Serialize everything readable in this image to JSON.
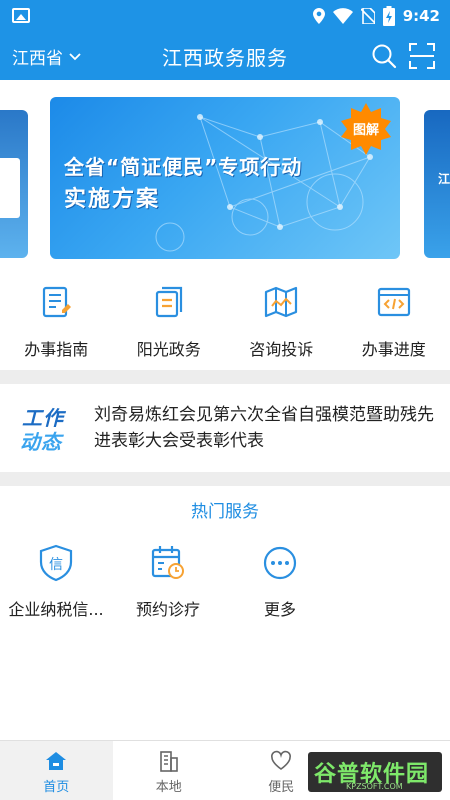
{
  "status_bar": {
    "time": "9:42"
  },
  "header": {
    "province": "江西省",
    "title": "江西政务服务"
  },
  "banner": {
    "line1": "全省“简证便民”专项行动",
    "line2": "实施方案",
    "badge": "图解",
    "right_peek": "江"
  },
  "quick_menu": [
    {
      "label": "办事指南",
      "icon": "guide-icon"
    },
    {
      "label": "阳光政务",
      "icon": "document-icon"
    },
    {
      "label": "咨询投诉",
      "icon": "map-icon"
    },
    {
      "label": "办事进度",
      "icon": "code-window-icon"
    }
  ],
  "news": {
    "tag_line1": "工作",
    "tag_line2": "动态",
    "headline": "刘奇易炼红会见第六次全省自强模范暨助残先进表彰大会受表彰代表"
  },
  "hot_services": {
    "title": "热门服务",
    "items": [
      {
        "label": "企业纳税信...",
        "icon": "credit-shield-icon"
      },
      {
        "label": "预约诊疗",
        "icon": "calendar-clock-icon"
      },
      {
        "label": "更多",
        "icon": "more-icon"
      }
    ]
  },
  "bottom_nav": [
    {
      "label": "首页",
      "icon": "home-icon",
      "active": true
    },
    {
      "label": "本地",
      "icon": "building-icon",
      "active": false
    },
    {
      "label": "便民",
      "icon": "heart-icon",
      "active": false
    }
  ],
  "watermark": {
    "text": "谷普软件园",
    "sub": "KPZSOFT.COM"
  },
  "colors": {
    "primary": "#1e93e6",
    "accent": "#1e8de2",
    "divider": "#ededed"
  }
}
